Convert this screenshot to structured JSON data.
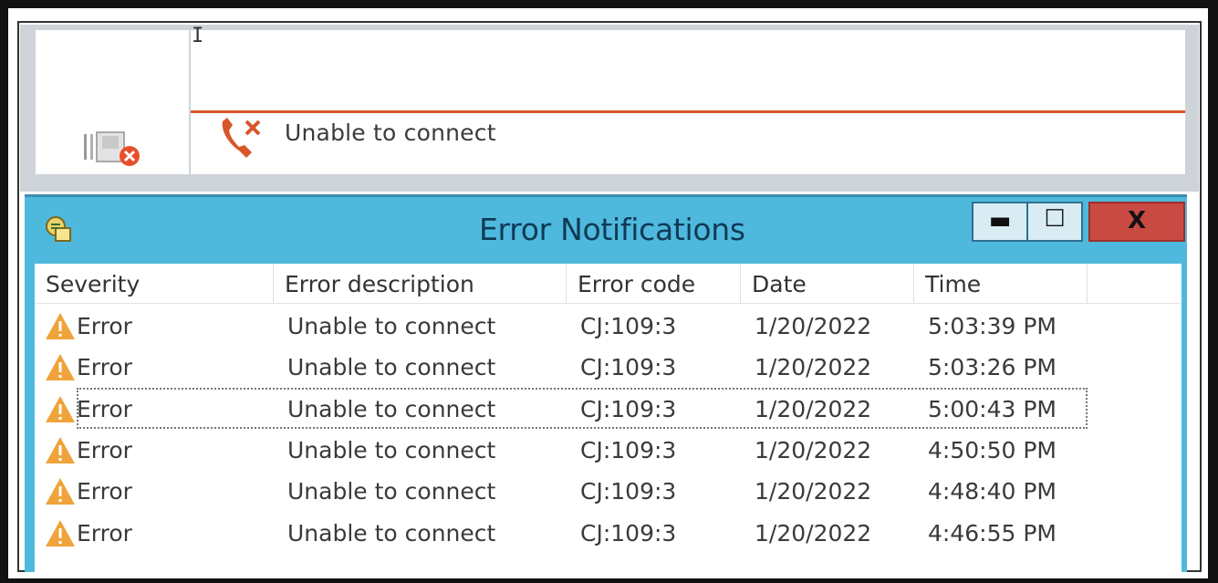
{
  "app": {
    "cursor_mark": "I",
    "status_text": "Unable to connect",
    "icons": {
      "device": "device-error-icon",
      "phone": "phone-disconnected-icon"
    },
    "accent_color": "#d9552a"
  },
  "window": {
    "title": "Error Notifications",
    "icon": "notification-app-icon",
    "controls": {
      "minimize": "▬",
      "maximize": "☐",
      "close": "X"
    },
    "title_bar_color": "#4fb9dd",
    "close_color": "#c94a42"
  },
  "table": {
    "columns": [
      "Severity",
      "Error description",
      "Error code",
      "Date",
      "Time"
    ],
    "rows": [
      {
        "severity": "Error",
        "description": "Unable to connect",
        "code": "CJ:109:3",
        "date": "1/20/2022",
        "time": "5:03:39 PM",
        "selected": false
      },
      {
        "severity": "Error",
        "description": "Unable to connect",
        "code": "CJ:109:3",
        "date": "1/20/2022",
        "time": "5:03:26 PM",
        "selected": false
      },
      {
        "severity": "Error",
        "description": "Unable to connect",
        "code": "CJ:109:3",
        "date": "1/20/2022",
        "time": "5:00:43 PM",
        "selected": true
      },
      {
        "severity": "Error",
        "description": "Unable to connect",
        "code": "CJ:109:3",
        "date": "1/20/2022",
        "time": "4:50:50 PM",
        "selected": false
      },
      {
        "severity": "Error",
        "description": "Unable to connect",
        "code": "CJ:109:3",
        "date": "1/20/2022",
        "time": "4:48:40 PM",
        "selected": false
      },
      {
        "severity": "Error",
        "description": "Unable to connect",
        "code": "CJ:109:3",
        "date": "1/20/2022",
        "time": "4:46:55 PM",
        "selected": false
      }
    ],
    "severity_icon": "warning-icon",
    "warning_color": "#f0a33a"
  }
}
